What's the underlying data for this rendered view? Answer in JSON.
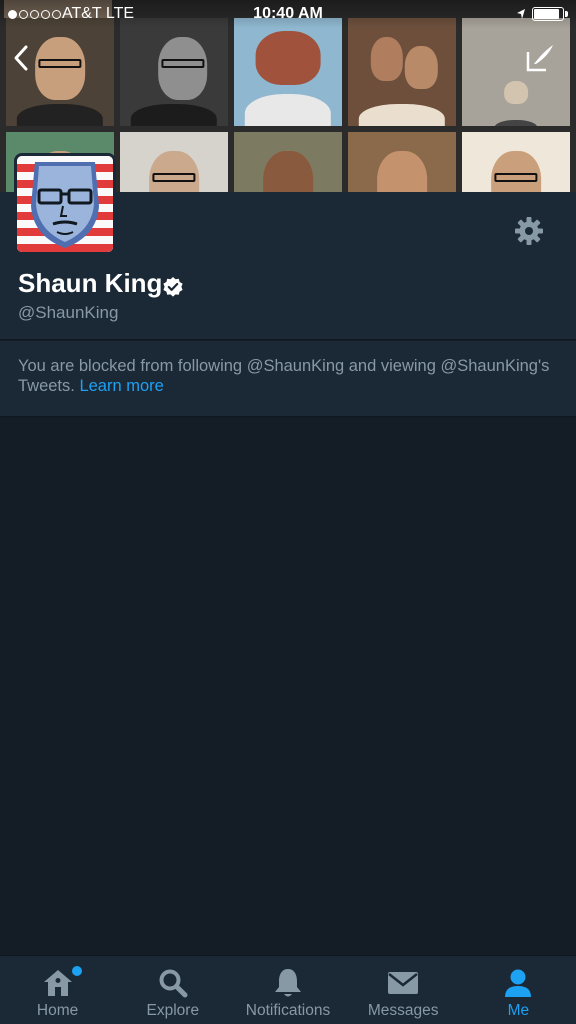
{
  "status_bar": {
    "carrier": "AT&T  LTE",
    "time": "10:40 AM",
    "signal_bars_filled": 1,
    "signal_bars_total": 5,
    "battery_level": 0.9
  },
  "header": {
    "back_icon": "chevron-left-icon",
    "compose_icon": "compose-icon"
  },
  "profile": {
    "display_name": "Shaun King",
    "screen_name": "@ShaunKing",
    "verified_icon": "verified-badge-icon",
    "settings_icon": "gear-icon"
  },
  "blocked_notice": {
    "text": "You are blocked from following @ShaunKing and viewing @ShaunKing's Tweets.",
    "link": "Learn more"
  },
  "tab_bar": {
    "tabs": [
      {
        "label": "Home",
        "icon": "home-icon",
        "active": false
      },
      {
        "label": "Explore",
        "icon": "search-icon",
        "active": false
      },
      {
        "label": "Notifications",
        "icon": "bell-icon",
        "active": false
      },
      {
        "label": "Messages",
        "icon": "envelope-icon",
        "active": false
      },
      {
        "label": "Me",
        "icon": "person-icon",
        "active": true
      }
    ]
  },
  "colors": {
    "background": "#141d26",
    "panel": "#1b2836",
    "accent": "#1da1f2",
    "secondary_text": "#8899a6"
  }
}
